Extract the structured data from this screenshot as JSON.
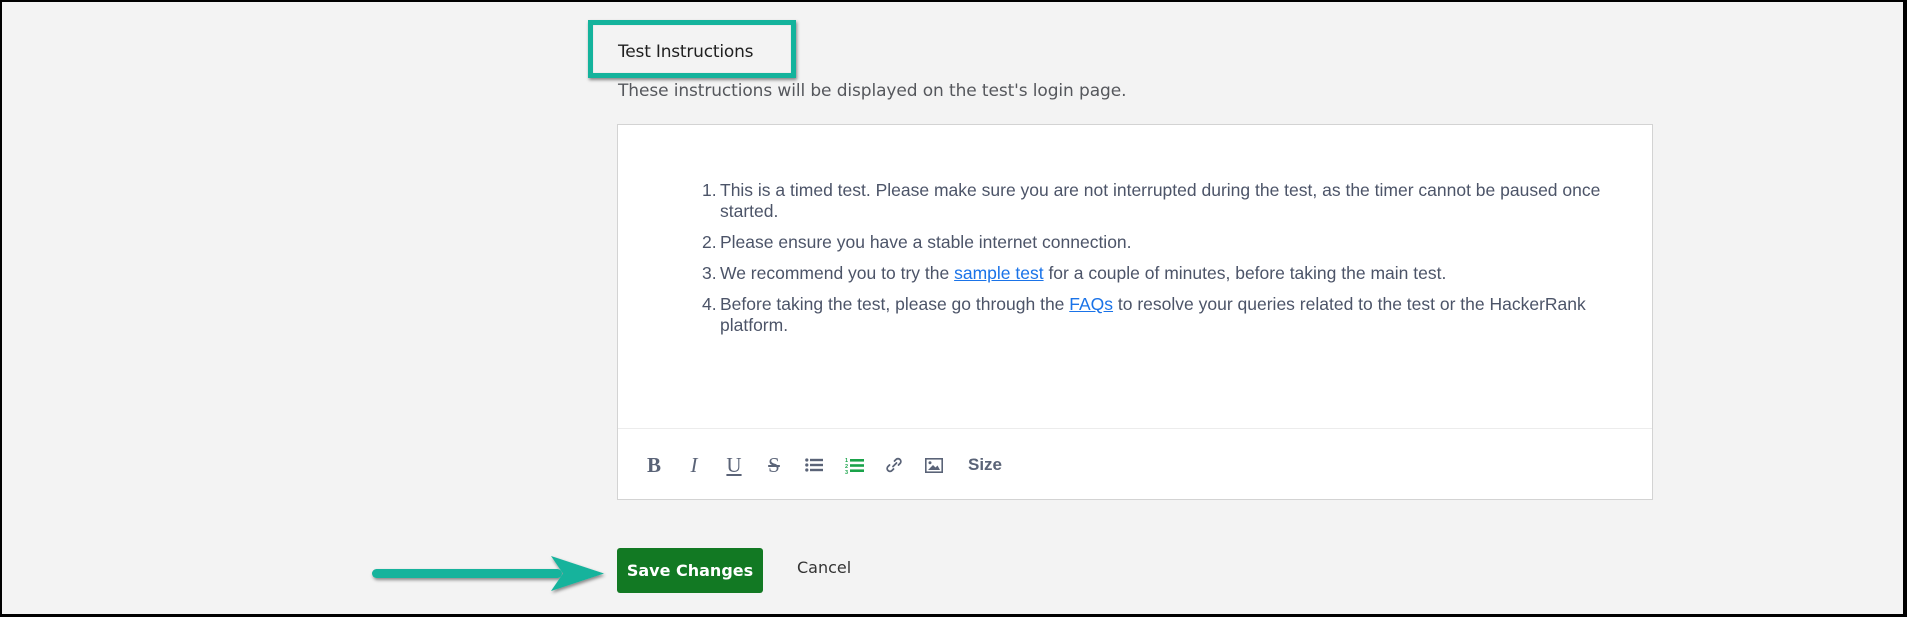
{
  "section": {
    "title": "Test Instructions",
    "description": "These instructions will be displayed on the test's login page."
  },
  "editor": {
    "items": [
      {
        "number": "1.",
        "segments": [
          {
            "text": "This is a timed test. Please make sure you are not interrupted during the test, as the timer cannot be paused once started."
          }
        ]
      },
      {
        "number": "2.",
        "segments": [
          {
            "text": "Please ensure you have a stable internet connection."
          }
        ]
      },
      {
        "number": "3.",
        "segments": [
          {
            "text": "We recommend you to try the "
          },
          {
            "text": "sample test",
            "link": true
          },
          {
            "text": " for a couple of minutes, before taking the main test."
          }
        ]
      },
      {
        "number": "4.",
        "segments": [
          {
            "text": "Before taking the test, please go through the "
          },
          {
            "text": "FAQs",
            "link": true
          },
          {
            "text": " to resolve your queries related to the test or the HackerRank platform."
          }
        ]
      }
    ],
    "toolbar": {
      "bold": "B",
      "italic": "I",
      "underline": "U",
      "strikethrough": "S",
      "size_label": "Size",
      "active_tool": "ordered-list",
      "active_color": "#1aa34a",
      "icon_color": "#5a6377"
    }
  },
  "actions": {
    "save_label": "Save Changes",
    "cancel_label": "Cancel",
    "save_color": "#127923"
  },
  "annotations": {
    "highlight_color": "#14b39c"
  }
}
